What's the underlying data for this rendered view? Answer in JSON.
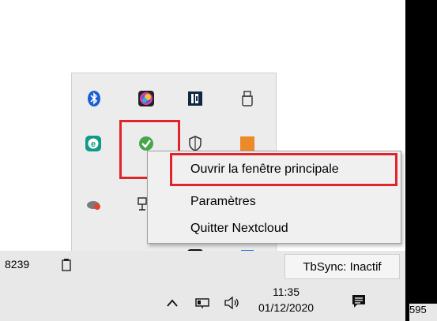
{
  "status_bar": {
    "left_number": "8239"
  },
  "tray": {
    "icons": [
      {
        "name": "bluetooth-icon"
      },
      {
        "name": "color-app-icon"
      },
      {
        "name": "app-d-icon"
      },
      {
        "name": "usb-drive-icon"
      },
      {
        "name": "e-app-icon"
      },
      {
        "name": "nextcloud-check-icon"
      },
      {
        "name": "shield-icon"
      },
      {
        "name": "orange-app-icon"
      },
      {
        "name": "cloud-fire-icon"
      },
      {
        "name": "network-pc-icon"
      },
      {
        "name": "target-app-icon"
      },
      {
        "name": "cloud-sync-icon"
      },
      {
        "name": "d-app-icon"
      },
      {
        "name": "blue-doc-icon"
      }
    ]
  },
  "context_menu": {
    "items": [
      {
        "label": "Ouvrir la fenêtre principale"
      },
      {
        "label": "Paramètres"
      },
      {
        "label": "Quitter Nextcloud"
      }
    ]
  },
  "taskbar": {
    "sync_status": "TbSync: Inactif",
    "time": "11:35",
    "date": "01/12/2020",
    "right_partial": "595"
  },
  "colors": {
    "highlight_red": "#e1242b",
    "tray_bg": "#ececec",
    "menu_bg": "#f0f0f0"
  }
}
